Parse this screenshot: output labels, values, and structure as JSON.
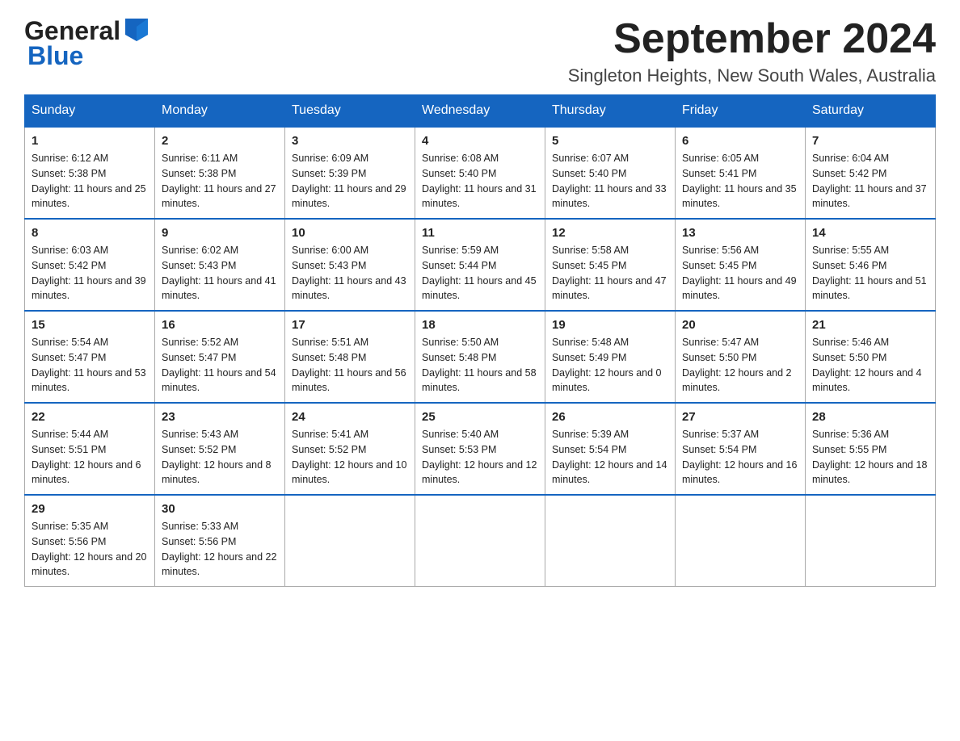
{
  "header": {
    "logo_general": "General",
    "logo_blue": "Blue",
    "month_year": "September 2024",
    "location": "Singleton Heights, New South Wales, Australia"
  },
  "days_of_week": [
    "Sunday",
    "Monday",
    "Tuesday",
    "Wednesday",
    "Thursday",
    "Friday",
    "Saturday"
  ],
  "weeks": [
    [
      {
        "day": "1",
        "sunrise": "6:12 AM",
        "sunset": "5:38 PM",
        "daylight": "11 hours and 25 minutes."
      },
      {
        "day": "2",
        "sunrise": "6:11 AM",
        "sunset": "5:38 PM",
        "daylight": "11 hours and 27 minutes."
      },
      {
        "day": "3",
        "sunrise": "6:09 AM",
        "sunset": "5:39 PM",
        "daylight": "11 hours and 29 minutes."
      },
      {
        "day": "4",
        "sunrise": "6:08 AM",
        "sunset": "5:40 PM",
        "daylight": "11 hours and 31 minutes."
      },
      {
        "day": "5",
        "sunrise": "6:07 AM",
        "sunset": "5:40 PM",
        "daylight": "11 hours and 33 minutes."
      },
      {
        "day": "6",
        "sunrise": "6:05 AM",
        "sunset": "5:41 PM",
        "daylight": "11 hours and 35 minutes."
      },
      {
        "day": "7",
        "sunrise": "6:04 AM",
        "sunset": "5:42 PM",
        "daylight": "11 hours and 37 minutes."
      }
    ],
    [
      {
        "day": "8",
        "sunrise": "6:03 AM",
        "sunset": "5:42 PM",
        "daylight": "11 hours and 39 minutes."
      },
      {
        "day": "9",
        "sunrise": "6:02 AM",
        "sunset": "5:43 PM",
        "daylight": "11 hours and 41 minutes."
      },
      {
        "day": "10",
        "sunrise": "6:00 AM",
        "sunset": "5:43 PM",
        "daylight": "11 hours and 43 minutes."
      },
      {
        "day": "11",
        "sunrise": "5:59 AM",
        "sunset": "5:44 PM",
        "daylight": "11 hours and 45 minutes."
      },
      {
        "day": "12",
        "sunrise": "5:58 AM",
        "sunset": "5:45 PM",
        "daylight": "11 hours and 47 minutes."
      },
      {
        "day": "13",
        "sunrise": "5:56 AM",
        "sunset": "5:45 PM",
        "daylight": "11 hours and 49 minutes."
      },
      {
        "day": "14",
        "sunrise": "5:55 AM",
        "sunset": "5:46 PM",
        "daylight": "11 hours and 51 minutes."
      }
    ],
    [
      {
        "day": "15",
        "sunrise": "5:54 AM",
        "sunset": "5:47 PM",
        "daylight": "11 hours and 53 minutes."
      },
      {
        "day": "16",
        "sunrise": "5:52 AM",
        "sunset": "5:47 PM",
        "daylight": "11 hours and 54 minutes."
      },
      {
        "day": "17",
        "sunrise": "5:51 AM",
        "sunset": "5:48 PM",
        "daylight": "11 hours and 56 minutes."
      },
      {
        "day": "18",
        "sunrise": "5:50 AM",
        "sunset": "5:48 PM",
        "daylight": "11 hours and 58 minutes."
      },
      {
        "day": "19",
        "sunrise": "5:48 AM",
        "sunset": "5:49 PM",
        "daylight": "12 hours and 0 minutes."
      },
      {
        "day": "20",
        "sunrise": "5:47 AM",
        "sunset": "5:50 PM",
        "daylight": "12 hours and 2 minutes."
      },
      {
        "day": "21",
        "sunrise": "5:46 AM",
        "sunset": "5:50 PM",
        "daylight": "12 hours and 4 minutes."
      }
    ],
    [
      {
        "day": "22",
        "sunrise": "5:44 AM",
        "sunset": "5:51 PM",
        "daylight": "12 hours and 6 minutes."
      },
      {
        "day": "23",
        "sunrise": "5:43 AM",
        "sunset": "5:52 PM",
        "daylight": "12 hours and 8 minutes."
      },
      {
        "day": "24",
        "sunrise": "5:41 AM",
        "sunset": "5:52 PM",
        "daylight": "12 hours and 10 minutes."
      },
      {
        "day": "25",
        "sunrise": "5:40 AM",
        "sunset": "5:53 PM",
        "daylight": "12 hours and 12 minutes."
      },
      {
        "day": "26",
        "sunrise": "5:39 AM",
        "sunset": "5:54 PM",
        "daylight": "12 hours and 14 minutes."
      },
      {
        "day": "27",
        "sunrise": "5:37 AM",
        "sunset": "5:54 PM",
        "daylight": "12 hours and 16 minutes."
      },
      {
        "day": "28",
        "sunrise": "5:36 AM",
        "sunset": "5:55 PM",
        "daylight": "12 hours and 18 minutes."
      }
    ],
    [
      {
        "day": "29",
        "sunrise": "5:35 AM",
        "sunset": "5:56 PM",
        "daylight": "12 hours and 20 minutes."
      },
      {
        "day": "30",
        "sunrise": "5:33 AM",
        "sunset": "5:56 PM",
        "daylight": "12 hours and 22 minutes."
      },
      null,
      null,
      null,
      null,
      null
    ]
  ],
  "labels": {
    "sunrise": "Sunrise:",
    "sunset": "Sunset:",
    "daylight": "Daylight:"
  }
}
